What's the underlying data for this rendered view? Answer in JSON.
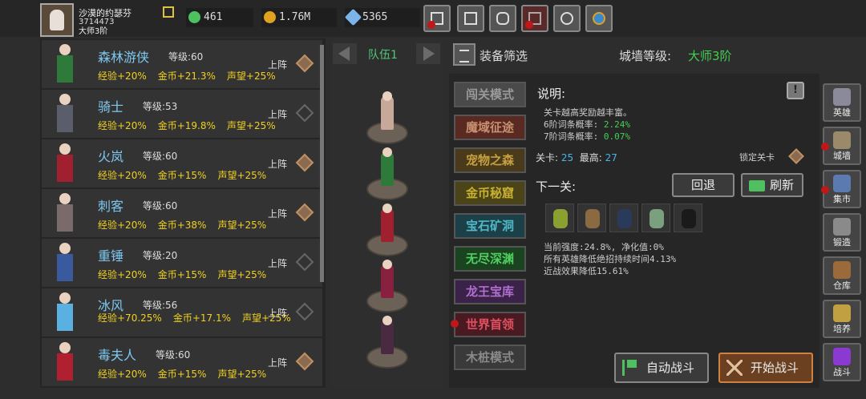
{
  "player": {
    "name": "沙漠的约瑟芬",
    "id": "3714473",
    "rank": "大师3阶"
  },
  "resources": [
    {
      "icon": "energy-icon",
      "value": "461",
      "color": "#4ec060"
    },
    {
      "icon": "gold-coin-icon",
      "value": "1.76M",
      "color": "#e0a020"
    },
    {
      "icon": "diamond-icon",
      "value": "5365",
      "color": "#7ab4e8"
    }
  ],
  "top_buttons": [
    "shop-icon",
    "mail-icon",
    "gamepad-icon",
    "event-icon",
    "settings-icon",
    "spin-wheel-icon"
  ],
  "heroes": [
    {
      "name": "森林游侠",
      "level_label": "等级:",
      "level": "60",
      "exp": "经验+20%",
      "gold": "金币+21.3%",
      "fame": "声望+25%",
      "action": "上阵",
      "selected": true,
      "color": "#2e7a3a"
    },
    {
      "name": "骑士",
      "level_label": "等级:",
      "level": "53",
      "exp": "经验+20%",
      "gold": "金币+19.8%",
      "fame": "声望+25%",
      "action": "上阵",
      "selected": false,
      "color": "#5a5e6a"
    },
    {
      "name": "火岚",
      "level_label": "等级:",
      "level": "60",
      "exp": "经验+20%",
      "gold": "金币+15%",
      "fame": "声望+25%",
      "action": "上阵",
      "selected": true,
      "color": "#a02030"
    },
    {
      "name": "刺客",
      "level_label": "等级:",
      "level": "60",
      "exp": "经验+20%",
      "gold": "金币+38%",
      "fame": "声望+25%",
      "action": "上阵",
      "selected": true,
      "color": "#7a6a6a"
    },
    {
      "name": "重锤",
      "level_label": "等级:",
      "level": "20",
      "exp": "经验+20%",
      "gold": "金币+15%",
      "fame": "声望+25%",
      "action": "上阵",
      "selected": false,
      "color": "#3a5aa0"
    },
    {
      "name": "冰风",
      "level_label": "等级:",
      "level": "56",
      "exp": "经验+70.25%",
      "gold": "金币+17.1%",
      "fame": "声望+25%",
      "action": "上阵",
      "selected": false,
      "color": "#5ab0e0"
    },
    {
      "name": "毒夫人",
      "level_label": "等级:",
      "level": "60",
      "exp": "经验+20%",
      "gold": "金币+15%",
      "fame": "声望+25%",
      "action": "上阵",
      "selected": true,
      "color": "#b02030"
    }
  ],
  "team": {
    "label": "队伍1",
    "members": [
      {
        "color": "#c8a898"
      },
      {
        "color": "#2e7a3a"
      },
      {
        "color": "#a02030"
      },
      {
        "color": "#8a2040"
      },
      {
        "color": "#4a2a40"
      }
    ]
  },
  "filter_label": "装备筛选",
  "wall": {
    "label": "城墙等级:",
    "value": "大师3阶"
  },
  "modes": [
    {
      "label": "闯关模式",
      "bg": "#4a4a4a",
      "fg": "#9a9a9a",
      "alert": false
    },
    {
      "label": "魔域征途",
      "bg": "#5a2a22",
      "fg": "#c89070",
      "alert": false
    },
    {
      "label": "宠物之森",
      "bg": "#4a3a1c",
      "fg": "#c8a040",
      "alert": false
    },
    {
      "label": "金币秘窟",
      "bg": "#4a4418",
      "fg": "#c8b030",
      "alert": false
    },
    {
      "label": "宝石矿洞",
      "bg": "#1c4048",
      "fg": "#50b8c8",
      "alert": false
    },
    {
      "label": "无尽深渊",
      "bg": "#1a4420",
      "fg": "#50d060",
      "alert": false
    },
    {
      "label": "龙王宝库",
      "bg": "#3a2248",
      "fg": "#b070d0",
      "alert": false
    },
    {
      "label": "世界首领",
      "bg": "#4a1a22",
      "fg": "#e05060",
      "alert": true
    },
    {
      "label": "木桩模式",
      "bg": "#3a3a3a",
      "fg": "#8a8a8a",
      "alert": false
    }
  ],
  "desc": {
    "title": "说明:",
    "help": "!",
    "line1": "关卡越高奖励越丰富。",
    "line2_label": "6阶词条概率:",
    "line2_value": "2.24%",
    "line3_label": "7阶词条概率:",
    "line3_value": "0.07%"
  },
  "stage": {
    "label": "关卡:",
    "value": "25",
    "best_label": "最高:",
    "best_value": "27",
    "lock_label": "锁定关卡"
  },
  "next": {
    "label": "下一关:",
    "back_button": "回退",
    "refresh_button": "刷新",
    "enemies": [
      {
        "color": "#8aa030"
      },
      {
        "color": "#8a6a40"
      },
      {
        "color": "#2a3a5a"
      },
      {
        "color": "#7aa080"
      },
      {
        "color": "#1a1a1a"
      }
    ]
  },
  "stats": {
    "line1": "当前强度:24.8%, 净化值:0%",
    "line2": "所有英雄降低绝招持续时间4.13%",
    "line3": "近战效果降低15.61%"
  },
  "battle": {
    "auto_label": "自动战斗",
    "start_label": "开始战斗"
  },
  "right_menu": [
    {
      "label": "英雄",
      "icon": "helmet-icon",
      "color": "#8a8a9a",
      "alert": false
    },
    {
      "label": "城墙",
      "icon": "castle-icon",
      "color": "#9a8a6a",
      "alert": true
    },
    {
      "label": "集市",
      "icon": "market-icon",
      "color": "#5a7ab0",
      "alert": true
    },
    {
      "label": "锻造",
      "icon": "anvil-icon",
      "color": "#8a8a8a",
      "alert": false
    },
    {
      "label": "仓库",
      "icon": "warehouse-icon",
      "color": "#9a6a3a",
      "alert": false
    },
    {
      "label": "培养",
      "icon": "cultivate-icon",
      "color": "#c0a040",
      "alert": false
    },
    {
      "label": "战斗",
      "icon": "portal-icon",
      "color": "#8a3ad0",
      "alert": false
    }
  ]
}
